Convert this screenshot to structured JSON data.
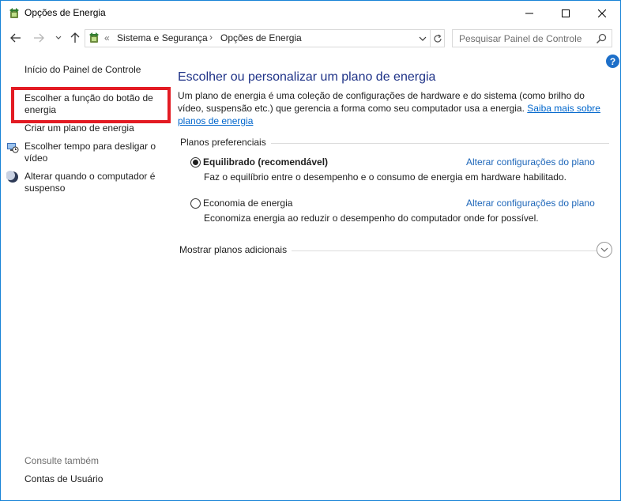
{
  "window": {
    "title": "Opções de Energia",
    "icons": {
      "app": "power-options-icon",
      "minimize": "minimize-icon",
      "maximize": "maximize-icon",
      "close": "close-icon"
    }
  },
  "nav": {
    "icons": {
      "back": "arrow-left-icon",
      "forward": "arrow-right-icon",
      "recent": "chevron-down-icon",
      "up": "arrow-up-icon"
    },
    "address": {
      "overflow": "«",
      "breadcrumbs": [
        "Sistema e Segurança",
        "Opções de Energia"
      ],
      "separator": "›"
    },
    "search": {
      "placeholder": "Pesquisar Painel de Controle"
    }
  },
  "help": {
    "label": "?"
  },
  "left_pane": {
    "home": "Início do Painel de Controle",
    "items": [
      {
        "label": "Escolher a função do botão de energia",
        "highlighted": true
      },
      {
        "label": "Criar um plano de energia"
      },
      {
        "label": "Escolher tempo para desligar o vídeo",
        "icon": "display-timer-icon"
      },
      {
        "label": "Alterar quando o computador é suspenso",
        "icon": "moon-icon"
      }
    ],
    "see_also": {
      "title": "Consulte também",
      "links": [
        "Contas de Usuário"
      ]
    }
  },
  "main": {
    "title": "Escolher ou personalizar um plano de energia",
    "description": "Um plano de energia é uma coleção de configurações de hardware e do sistema (como brilho do vídeo, suspensão etc.) que gerencia a forma como seu computador usa a energia. ",
    "learn_more": "Saiba mais sobre planos de energia",
    "preferred_title": "Planos preferenciais",
    "plans": [
      {
        "name": "Equilibrado (recomendável)",
        "selected": true,
        "change_link": "Alterar configurações do plano",
        "description": "Faz o equilíbrio entre o desempenho e o consumo de energia em hardware habilitado."
      },
      {
        "name": "Economia de energia",
        "selected": false,
        "change_link": "Alterar configurações do plano",
        "description": "Economiza energia ao reduzir o desempenho do computador onde for possível."
      }
    ],
    "more_plans": "Mostrar planos adicionais"
  },
  "colors": {
    "accent_border": "#1883d7",
    "highlight_box": "#e31b23",
    "title": "#1e3287",
    "link": "#1d66b9"
  }
}
